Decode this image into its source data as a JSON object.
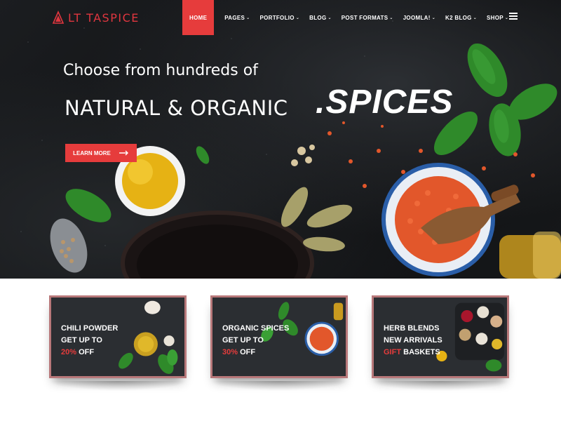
{
  "brand": {
    "name": "LT TASPICE",
    "accent_color": "#e63c3c"
  },
  "nav": {
    "items": [
      {
        "label": "HOME",
        "active": true,
        "caret": ""
      },
      {
        "label": "PAGES",
        "active": false,
        "caret": "⌄"
      },
      {
        "label": "PORTFOLIO",
        "active": false,
        "caret": "⌄"
      },
      {
        "label": "BLOG",
        "active": false,
        "caret": "⌄"
      },
      {
        "label": "POST FORMATS",
        "active": false,
        "caret": "⌄"
      },
      {
        "label": "JOOMLA!",
        "active": false,
        "caret": "⌄"
      },
      {
        "label": "K2 BLOG",
        "active": false,
        "caret": "⌄"
      },
      {
        "label": "SHOP",
        "active": false,
        "caret": "⌄"
      }
    ],
    "menu_icon": "hamburger-icon"
  },
  "hero": {
    "subtitle": "Choose from hundreds of",
    "title": "NATURAL & ORGANIC",
    "accent": ".SPICES",
    "cta_label": "LEARN MORE"
  },
  "promos": [
    {
      "line1": "CHILI POWDER",
      "line2": "GET UP TO",
      "highlight": "20%",
      "line3_rest": " OFF"
    },
    {
      "line1": "ORGANIC SPICES",
      "line2": "GET UP TO",
      "highlight": "30%",
      "line3_rest": " OFF"
    },
    {
      "line1": "HERB BLENDS",
      "line2": "NEW ARRIVALS",
      "highlight": "GIFT",
      "line3_rest": " BASKETS"
    }
  ]
}
